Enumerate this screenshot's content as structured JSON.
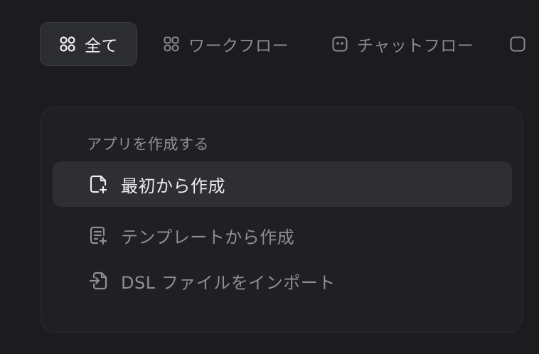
{
  "tabs": [
    {
      "label": "全て",
      "icon": "grid-icon",
      "active": true
    },
    {
      "label": "ワークフロー",
      "icon": "workflow-icon",
      "active": false
    },
    {
      "label": "チャットフロー",
      "icon": "chatflow-icon",
      "active": false
    }
  ],
  "create_menu": {
    "title": "アプリを作成する",
    "items": [
      {
        "label": "最初から作成",
        "icon": "new-file-icon",
        "highlighted": true
      },
      {
        "label": "テンプレートから作成",
        "icon": "template-icon",
        "highlighted": false
      },
      {
        "label": "DSL ファイルをインポート",
        "icon": "import-icon",
        "highlighted": false
      }
    ]
  },
  "colors": {
    "background": "#1c1c1e",
    "card": "#202023",
    "highlight": "#2e2e33",
    "text_active": "#f2f2f4",
    "text_muted": "#8e8e94"
  }
}
